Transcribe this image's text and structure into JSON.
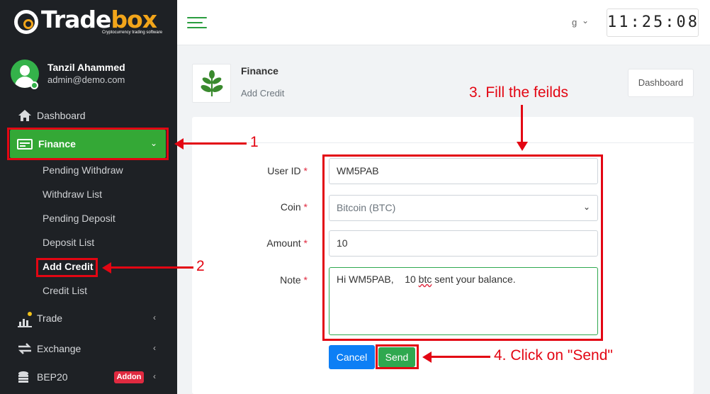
{
  "brand": {
    "name_part1": "Trade",
    "name_part2": "box",
    "tagline": "Cryptocurrency trading software"
  },
  "user": {
    "name": "Tanzil Ahammed",
    "email": "admin@demo.com"
  },
  "sidebar": {
    "dashboard": "Dashboard",
    "finance": "Finance",
    "finance_items": [
      "Pending Withdraw",
      "Withdraw List",
      "Pending Deposit",
      "Deposit List",
      "Add Credit",
      "Credit List"
    ],
    "trade": "Trade",
    "exchange": "Exchange",
    "bep20": "BEP20",
    "addon_badge": "Addon"
  },
  "topbar": {
    "language": "g",
    "clock": "11:25:08"
  },
  "page": {
    "title": "Finance",
    "subtitle": "Add Credit",
    "dashboard_button": "Dashboard"
  },
  "form": {
    "user_id_label": "User ID",
    "user_id_value": "WM5PAB",
    "coin_label": "Coin",
    "coin_value": "Bitcoin (BTC)",
    "amount_label": "Amount",
    "amount_value": "10",
    "note_label": "Note",
    "note_value_pre": "Hi WM5PAB,    10 ",
    "note_value_spell": "btc",
    "note_value_post": " sent your balance.",
    "required_mark": "*",
    "cancel": "Cancel",
    "send": "Send"
  },
  "annotations": {
    "step1": "1",
    "step2": "2",
    "step3": "3. Fill the feilds",
    "step4": "4. Click on \"Send\""
  },
  "colors": {
    "accent": "#34a836",
    "sidebar_bg": "#1e2125",
    "annotation": "#e30613",
    "cancel": "#0d7ff5",
    "badge": "#e02a40"
  }
}
